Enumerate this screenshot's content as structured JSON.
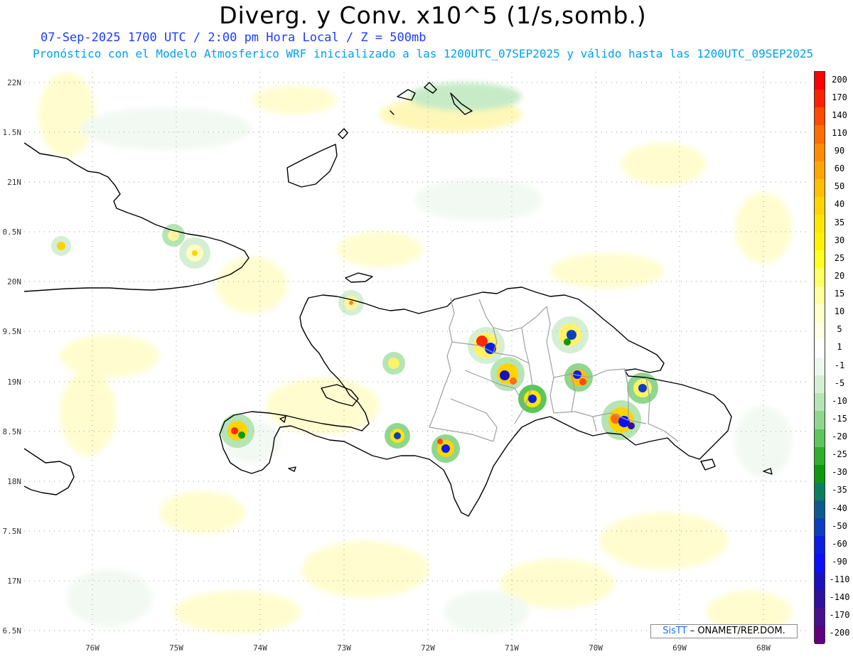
{
  "title": "Diverg. y Conv. x10^5 (1/s,somb.)",
  "subtitle1": "07-Sep-2025  1700 UTC / 2:00 pm Hora Local / Z = 500mb",
  "subtitle2": "Pronóstico con el Modelo Atmosferico WRF inicializado a las 1200UTC_07SEP2025 y válido hasta las  1200UTC_09SEP2025",
  "lat_labels": [
    "22N",
    "1.5N",
    "21N",
    "0.5N",
    "20N",
    "9.5N",
    "19N",
    "8.5N",
    "18N",
    "7.5N",
    "17N",
    "6.5N"
  ],
  "lon_labels": [
    "76W",
    "75W",
    "74W",
    "73W",
    "72W",
    "71W",
    "70W",
    "69W",
    "68W"
  ],
  "colorbar": {
    "labels": [
      "200",
      "170",
      "140",
      "110",
      "90",
      "60",
      "50",
      "40",
      "35",
      "30",
      "25",
      "20",
      "15",
      "10",
      "5",
      "1",
      "-1",
      "-5",
      "-10",
      "-15",
      "-20",
      "-25",
      "-30",
      "-35",
      "-40",
      "-50",
      "-60",
      "-90",
      "-110",
      "-140",
      "-170",
      "-200"
    ],
    "colors": [
      "#ff0000",
      "#ff2200",
      "#ff4a00",
      "#ff6e00",
      "#ff8c00",
      "#ffa500",
      "#ffbf00",
      "#ffd400",
      "#ffe600",
      "#fff200",
      "#ffff20",
      "#ffff66",
      "#ffffa0",
      "#ffffcc",
      "#ffffe6",
      "#ffffff",
      "#eef7ee",
      "#d4efd4",
      "#b5e4b5",
      "#8fd68f",
      "#5cc55c",
      "#2eb02e",
      "#0b9a0b",
      "#08805e",
      "#0a5a90",
      "#0a3fc0",
      "#0a1fe6",
      "#0a10ff",
      "#1a10c0",
      "#3010a0",
      "#481090",
      "#600080"
    ]
  },
  "credit": {
    "brand": "SisTT",
    "text": " – ONAMET/REP.DOM."
  }
}
